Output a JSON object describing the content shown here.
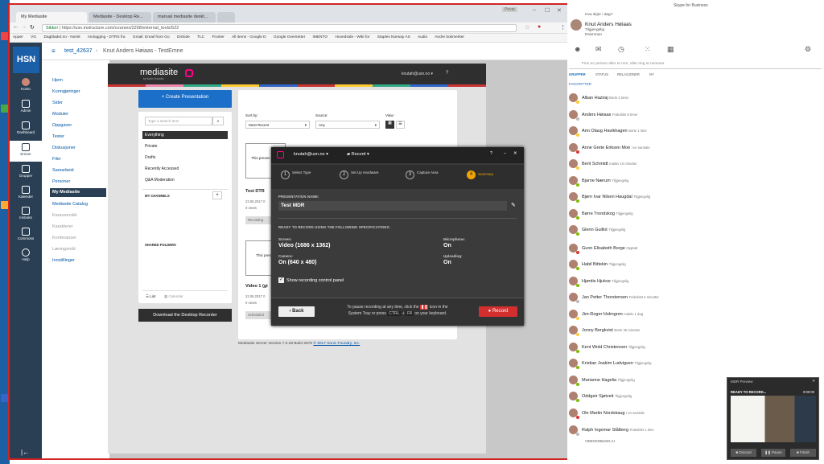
{
  "desktop": {
    "icons": [
      "app-icon",
      "app-icon",
      "app-icon",
      "app-icon"
    ]
  },
  "browser": {
    "tabs": [
      {
        "label": "My Mediasite",
        "active": true
      },
      {
        "label": "Mediasite - Desktop Re...",
        "active": false
      },
      {
        "label": "manual mediasite deskt...",
        "active": false
      }
    ],
    "profile": "Privat",
    "url_secure": "Sikker",
    "url": "https://usn.instructure.com/courses/2268/external_tools/522",
    "bookmarks": [
      "Apper",
      "VG",
      "Dagbladet.no - Norsk",
      "Innlogging - DTRS fra",
      "Gmail: Email from Go",
      "DirSide",
      "TLC",
      "Fronter",
      "All items - Google D",
      "Google Oversetter",
      "IMENTO",
      "Hovedside - Wiki for",
      "Staples Norway AS",
      "Audio",
      "Andre bokmerker"
    ]
  },
  "canvas_nav": {
    "logo": "HSN",
    "items": [
      {
        "label": "Konto",
        "icon": "avatar-icon"
      },
      {
        "label": "Admin",
        "icon": "shield-icon"
      },
      {
        "label": "Dashboard",
        "icon": "dashboard-icon"
      },
      {
        "label": "Emner",
        "icon": "book-icon"
      },
      {
        "label": "Grupper",
        "icon": "group-icon"
      },
      {
        "label": "Kalender",
        "icon": "calendar-icon"
      },
      {
        "label": "Innboks",
        "icon": "inbox-icon"
      },
      {
        "label": "Commons",
        "icon": "commons-icon"
      },
      {
        "label": "Help",
        "icon": "help-icon"
      }
    ]
  },
  "course": {
    "breadcrumb_code": "test_42637",
    "breadcrumb_sep": "›",
    "title": "Knut Anders Høiaas - TestEmne",
    "nav": [
      {
        "label": "Hjem",
        "state": "normal"
      },
      {
        "label": "Kunngjøringer",
        "state": "normal"
      },
      {
        "label": "Sider",
        "state": "normal"
      },
      {
        "label": "Moduler",
        "state": "normal"
      },
      {
        "label": "Oppgaver",
        "state": "normal"
      },
      {
        "label": "Tester",
        "state": "normal"
      },
      {
        "label": "Diskusjoner",
        "state": "normal"
      },
      {
        "label": "Filer",
        "state": "normal"
      },
      {
        "label": "Samarbeid",
        "state": "normal"
      },
      {
        "label": "Personer",
        "state": "normal"
      },
      {
        "label": "My Mediasite",
        "state": "active"
      },
      {
        "label": "Mediasite Catalog",
        "state": "normal"
      },
      {
        "label": "Karaoversikt",
        "state": "grey"
      },
      {
        "label": "Karakterer",
        "state": "grey"
      },
      {
        "label": "Konferanser",
        "state": "grey"
      },
      {
        "label": "Læringsmål",
        "state": "grey"
      },
      {
        "label": "Innstillinger",
        "state": "normal"
      }
    ]
  },
  "mediasite": {
    "logo": "mediasite",
    "logo_sub": "by sonic foundry",
    "user": "knutah@usn.no",
    "create_btn": "+ Create Presentation",
    "search_placeholder": "Type a search term",
    "filters": [
      "Everything",
      "Private",
      "Drafts",
      "Recently Accessed",
      "Q&A Moderation"
    ],
    "my_channels": "MY CHANNELS",
    "shared_folders": "SHARED FOLDERS",
    "view_list": "List",
    "view_calendar": "Calendar",
    "download_btn": "Download the Desktop Recorder",
    "sort_label": "Sort by:",
    "sort_value": "Most Recent",
    "source_label": "Source:",
    "source_value": "Any",
    "view_label": "View:",
    "presentations": [
      {
        "thumb": "This presen being",
        "title": "Test DTR",
        "date": "23.06.2017 0",
        "views": "0 views",
        "status": "Recording"
      },
      {
        "thumb": "This presen",
        "title": "Video 1 (gi",
        "date": "22.06.2017 0",
        "views": "0 views",
        "status": "Scheduled"
      }
    ],
    "footer_version": "Mediasite Server Version 7.0.29 Build 2976",
    "footer_copy": "© 2017 Sonic Foundry, Inc."
  },
  "record_dialog": {
    "user": "knutah@usn.no",
    "mode": "Record",
    "steps": [
      {
        "num": "1",
        "label": "Select Type"
      },
      {
        "num": "2",
        "label": "Set Up Hardware"
      },
      {
        "num": "3",
        "label": "Capture Area"
      },
      {
        "num": "4",
        "label": "Summary"
      }
    ],
    "pres_name_label": "PRESENTATION NAME:",
    "pres_name": "Test MDR",
    "ready_label": "READY TO RECORD USING THE FOLLOWING SPECIFICATIONS:",
    "screen_label": "Screen:",
    "screen_value": "Video (1686 x 1362)",
    "camera_label": "Camera:",
    "camera_value": "On (640 x 480)",
    "mic_label": "Microphone:",
    "mic_value": "On",
    "upload_label": "Uploading:",
    "upload_value": "On",
    "show_control": "Show recording control panel",
    "back": "Back",
    "record": "Record",
    "pause_hint_1": "To pause recording at any time, click the",
    "pause_hint_2": "icon in the",
    "pause_hint_3": "System Tray or press",
    "pause_key1": "CTRL",
    "pause_key2": "F8",
    "pause_hint_4": "on your keyboard."
  },
  "skype": {
    "title": "Skype for Business",
    "status_q": "Hva skjer i dag?",
    "me_name": "Knut Anders Høiaas",
    "me_status": "Tilgjengelig",
    "me_location": "Drammen",
    "search_placeholder": "Finn en person eller et rom, eller ring et nummer",
    "tabs": [
      "GRUPPER",
      "STATUS",
      "RELASJONER",
      "NY"
    ],
    "group": "FAVORITTER",
    "contacts": [
      {
        "name": "Alban Haziraj",
        "status": "Borte 2 timer"
      },
      {
        "name": "Anders Høiaas",
        "status": "Frakoblet 8 timer"
      },
      {
        "name": "Ann Olaug Havikhagen",
        "status": "Borte 1 time"
      },
      {
        "name": "Anne Grete Eriksen Moe",
        "status": "I en samtale"
      },
      {
        "name": "Berit Schmidt",
        "status": "Inaktiv 10 minutter"
      },
      {
        "name": "Bjarne Nærum",
        "status": "Tilgjengelig"
      },
      {
        "name": "Bjørn Ivar Nilsen Haugdal",
        "status": "Tilgjengelig"
      },
      {
        "name": "Børre Trondskog",
        "status": "Tilgjengelig"
      },
      {
        "name": "Glenn Guillot",
        "status": "Tilgjengelig"
      },
      {
        "name": "Gunn Elisabeth Borge",
        "status": "Opptatt"
      },
      {
        "name": "Habil Bittekin",
        "status": "Tilgjengelig"
      },
      {
        "name": "Hjørdis Hjukse",
        "status": "Tilgjengelig"
      },
      {
        "name": "Jan Petter Thorstensen",
        "status": "Frakoblet 5 minutter"
      },
      {
        "name": "Jim-Roger Holmgren",
        "status": "Inaktiv 1 dag"
      },
      {
        "name": "Jonny Bergkvist",
        "status": "Borte 35 minutter"
      },
      {
        "name": "Kent Wold Christensen",
        "status": "Tilgjengelig"
      },
      {
        "name": "Kristian Joakim Ludvigsen",
        "status": "Tilgjengelig"
      },
      {
        "name": "Marianne Hagelia",
        "status": "Tilgjengelig"
      },
      {
        "name": "Oddgeir Sjøtveit",
        "status": "Tilgjengelig"
      },
      {
        "name": "Ole Martin Nordskaug",
        "status": "I en samtale"
      },
      {
        "name": "Ralph Ingemar Stålberg",
        "status": "Frakoblet 1 time"
      }
    ],
    "bottom": "VIDEOSOBLING.AI"
  },
  "preview": {
    "title": "MDR Preview",
    "status": "READY TO RECORD...",
    "time": "0:00:00",
    "discard": "Discard",
    "pause": "Pause",
    "finish": "Finish"
  }
}
